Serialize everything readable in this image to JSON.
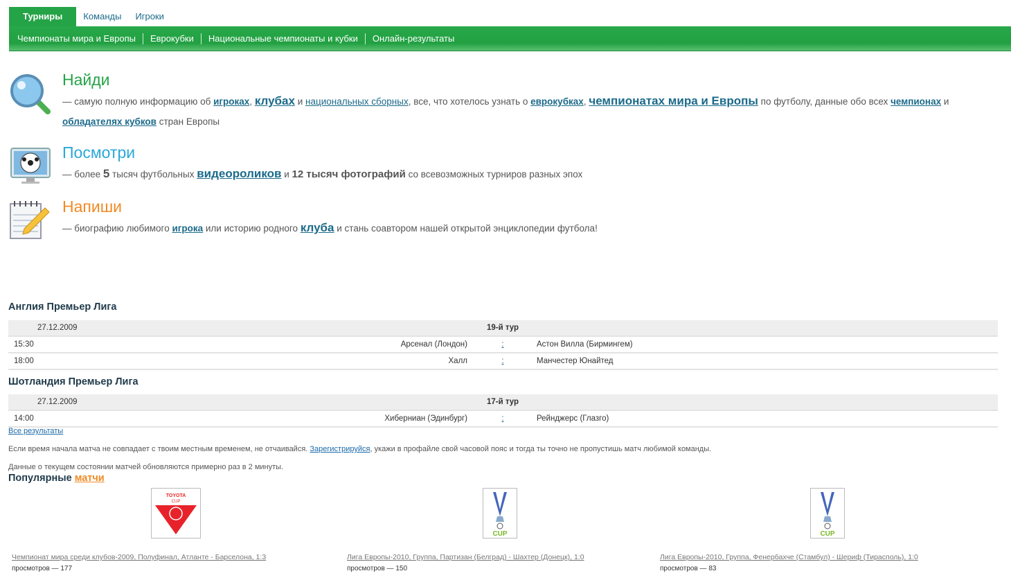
{
  "nav": {
    "tabs": [
      "Турниры",
      "Команды",
      "Игроки"
    ],
    "subnav": [
      "Чемпионаты мира и Европы",
      "Еврокубки",
      "Национальные чемпионаты и кубки",
      "Онлайн-результаты"
    ]
  },
  "find": {
    "title": "Найди",
    "t1": "— самую полную информацию об ",
    "l1": "игроках",
    "t2": ", ",
    "l2": "клубах",
    "t3": " и ",
    "l3": "национальных сборных",
    "t4": ", все, что хотелось узнать о ",
    "l4": "еврокубках",
    "t5": ", ",
    "l5": "чемпионатах мира и Европы",
    "t6": " по футболу, данные обо всех ",
    "l6": "чемпионах",
    "t7": " и ",
    "l7": "обладателях кубков",
    "t8": " стран Европы"
  },
  "watch": {
    "title": "Посмотри",
    "t1": "— более ",
    "b1": "5",
    "t2": " тысяч футбольных ",
    "l1": "видеороликов",
    "t3": " и ",
    "b2": "12 тысяч фотографий",
    "t4": " со всевозможных турниров разных эпох"
  },
  "write": {
    "title": "Напиши",
    "t1": "— биографию любимого ",
    "l1": "игрока",
    "t2": " или историю родного ",
    "l2": "клуба",
    "t3": " и стань соавтором нашей открытой энциклопедии футбола!"
  },
  "leagues": [
    {
      "name": "Англия Премьер Лига",
      "date": "27.12.2009",
      "round": "19-й тур",
      "matches": [
        {
          "time": "15:30",
          "home": "Арсенал (Лондон)",
          "score": " : ",
          "away": "Астон Вилла (Бирмингем)"
        },
        {
          "time": "18:00",
          "home": "Халл",
          "score": " : ",
          "away": "Манчестер Юнайтед"
        }
      ]
    },
    {
      "name": "Шотландия Премьер Лига",
      "date": "27.12.2009",
      "round": "17-й тур",
      "matches": [
        {
          "time": "14:00",
          "home": "Хиберниан (Эдинбург)",
          "score": " : ",
          "away": "Рейнджерс (Глазго)"
        }
      ]
    }
  ],
  "all_results": "Все результаты",
  "note1a": "Если время начала матча не совпадает с твоим местным временем, не отчаивайся. ",
  "note1link": "Зарегистрируйся",
  "note1b": ", укажи в профайле свой часовой пояс и тогда ты точно не пропустишь матч любимой команды.",
  "note2": "Данные о текущем состоянии матчей обновляются примерно раз в 2 минуты.",
  "popular": {
    "t": "Популярные ",
    "link": "матчи",
    "items": [
      {
        "logo": "TOYOTA CUP",
        "caption": "Чемпионат мира среди клубов-2009, Полуфинал, Атланте - Барселона, 1:3",
        "views": "просмотров — 177"
      },
      {
        "logo": "CUP",
        "caption": "Лига Европы-2010, Группа, Партизан (Белград) - Шахтер (Донецк), 1:0",
        "views": "просмотров — 150"
      },
      {
        "logo": "CUP",
        "caption": "Лига Европы-2010, Группа, Фенербахче (Стамбул) - Шериф (Тирасполь), 1:0",
        "views": "просмотров — 83"
      }
    ]
  }
}
